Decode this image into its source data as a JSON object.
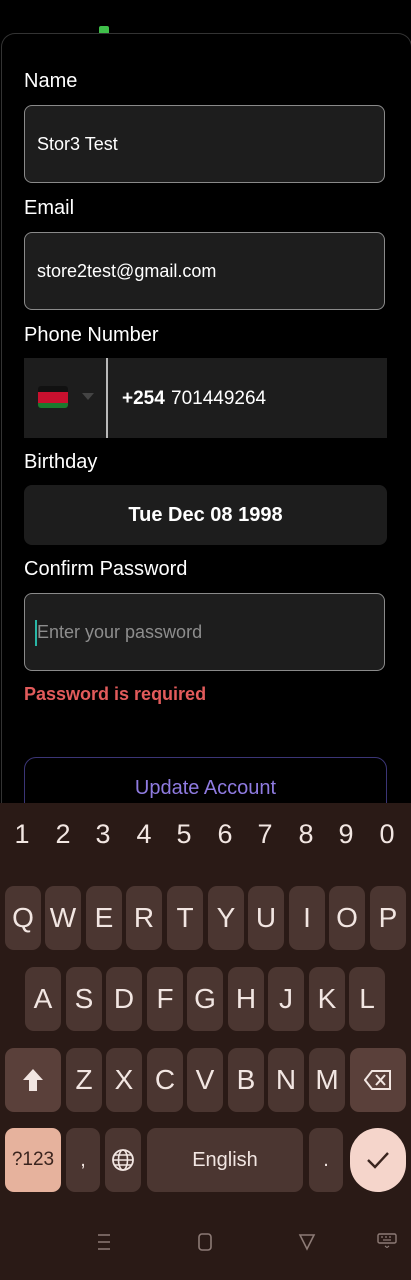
{
  "form": {
    "name_label": "Name",
    "name_value": "Stor3 Test",
    "email_label": "Email",
    "email_value": "store2test@gmail.com",
    "phone_label": "Phone Number",
    "phone_dial_code": "+254",
    "phone_value": "701449264",
    "birthday_label": "Birthday",
    "birthday_value": "Tue Dec 08 1998",
    "confirm_password_label": "Confirm Password",
    "confirm_password_placeholder": "Enter your password",
    "error_text": "Password is required",
    "update_button_label": "Update Account"
  },
  "keyboard": {
    "numbers": [
      "1",
      "2",
      "3",
      "4",
      "5",
      "6",
      "7",
      "8",
      "9",
      "0"
    ],
    "row1": [
      "Q",
      "W",
      "E",
      "R",
      "T",
      "Y",
      "U",
      "I",
      "O",
      "P"
    ],
    "row2": [
      "A",
      "S",
      "D",
      "F",
      "G",
      "H",
      "J",
      "K",
      "L"
    ],
    "row3": [
      "Z",
      "X",
      "C",
      "V",
      "B",
      "N",
      "M"
    ],
    "symbols_label": "?123",
    "comma": ",",
    "space_label": "English",
    "period": ".",
    "shift_icon": "shift-icon",
    "backspace_icon": "backspace-icon",
    "enter_icon": "check-icon",
    "globe_icon": "globe-icon"
  },
  "colors": {
    "background": "#000000",
    "field_bg": "#1d1d1d",
    "error": "#e25b5b",
    "accent": "#8f7be0",
    "keyboard_bg": "#2a1a16",
    "key_bg": "#4b3631"
  }
}
